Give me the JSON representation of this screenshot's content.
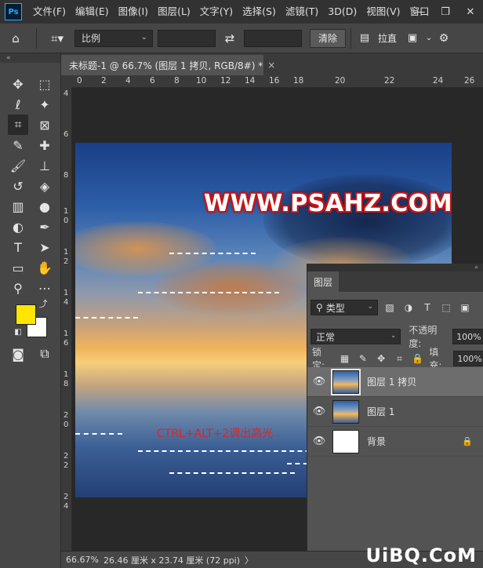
{
  "menubar": {
    "logo": "Ps",
    "items": [
      "文件(F)",
      "编辑(E)",
      "图像(I)",
      "图层(L)",
      "文字(Y)",
      "选择(S)",
      "滤镜(T)",
      "3D(D)",
      "视图(V)",
      "窗口"
    ],
    "window_controls": [
      "—",
      "❐",
      "✕"
    ]
  },
  "options": {
    "ratio_select": "比例",
    "clear_button": "清除",
    "straighten_label": "拉直"
  },
  "document": {
    "tab_title": "未标题-1 @ 66.7% (图层 1 拷贝, RGB/8#) *",
    "tab_close": "×",
    "watermark": "WWW.PSAHZ.COM",
    "annotation": "CTRL+ALT+2调出高光"
  },
  "rulers": {
    "top": [
      "0",
      "2",
      "4",
      "6",
      "8",
      "10",
      "12",
      "14",
      "16",
      "18",
      "20",
      "22",
      "24",
      "26"
    ],
    "left": [
      "4",
      "6",
      "8",
      "1\n0",
      "1\n2",
      "1\n4",
      "1\n6",
      "1\n8",
      "2\n0",
      "2\n2",
      "2\n4"
    ]
  },
  "statusbar": {
    "zoom": "66.67%",
    "size": "26.46 厘米 x 23.74 厘米 (72 ppi)",
    "arrow": "〉"
  },
  "layers_panel": {
    "tab": "图层",
    "filter_kind": "类型",
    "blend_mode": "正常",
    "opacity_label": "不透明度:",
    "opacity_value": "100%",
    "lock_label": "锁定:",
    "fill_label": "填充:",
    "fill_value": "100%",
    "layers": [
      {
        "name": "图层 1 拷贝",
        "selected": true
      },
      {
        "name": "图层 1",
        "selected": false
      },
      {
        "name": "背景",
        "selected": false,
        "locked": true
      }
    ]
  },
  "colors": {
    "foreground": "#ffe500",
    "background": "#ffffff"
  },
  "site_mark": "UiBQ.CoM"
}
